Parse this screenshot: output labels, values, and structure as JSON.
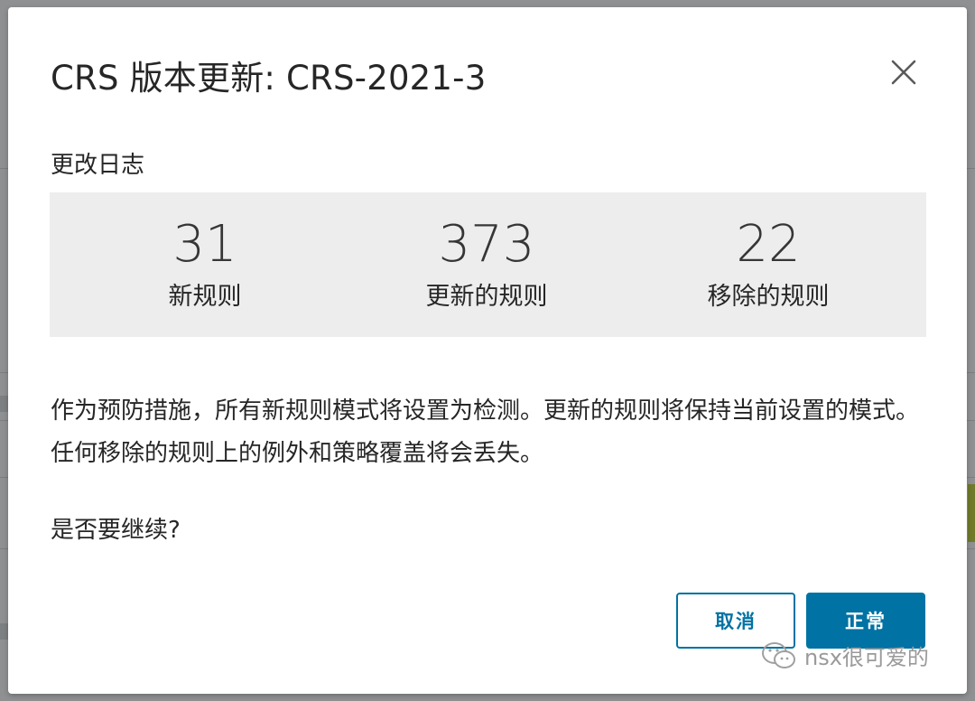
{
  "dialog": {
    "title": "CRS 版本更新: CRS-2021-3",
    "section_label": "更改日志",
    "stats": [
      {
        "value": "31",
        "label": "新规则"
      },
      {
        "value": "373",
        "label": "更新的规则"
      },
      {
        "value": "22",
        "label": "移除的规则"
      }
    ],
    "notice": "作为预防措施，所有新规则模式将设置为检测。更新的规则将保持当前设置的模式。任何移除的规则上的例外和策略覆盖将会丢失。",
    "question": "是否要继续?",
    "cancel_label": "取消",
    "ok_label": "正常"
  },
  "watermark": {
    "text": "nsx很可爱的",
    "icon": "wechat-icon"
  },
  "colors": {
    "primary": "#0072a3",
    "panel_bg": "#ededed",
    "overlay": "#8e9092"
  },
  "icons": {
    "close": "close-icon"
  }
}
